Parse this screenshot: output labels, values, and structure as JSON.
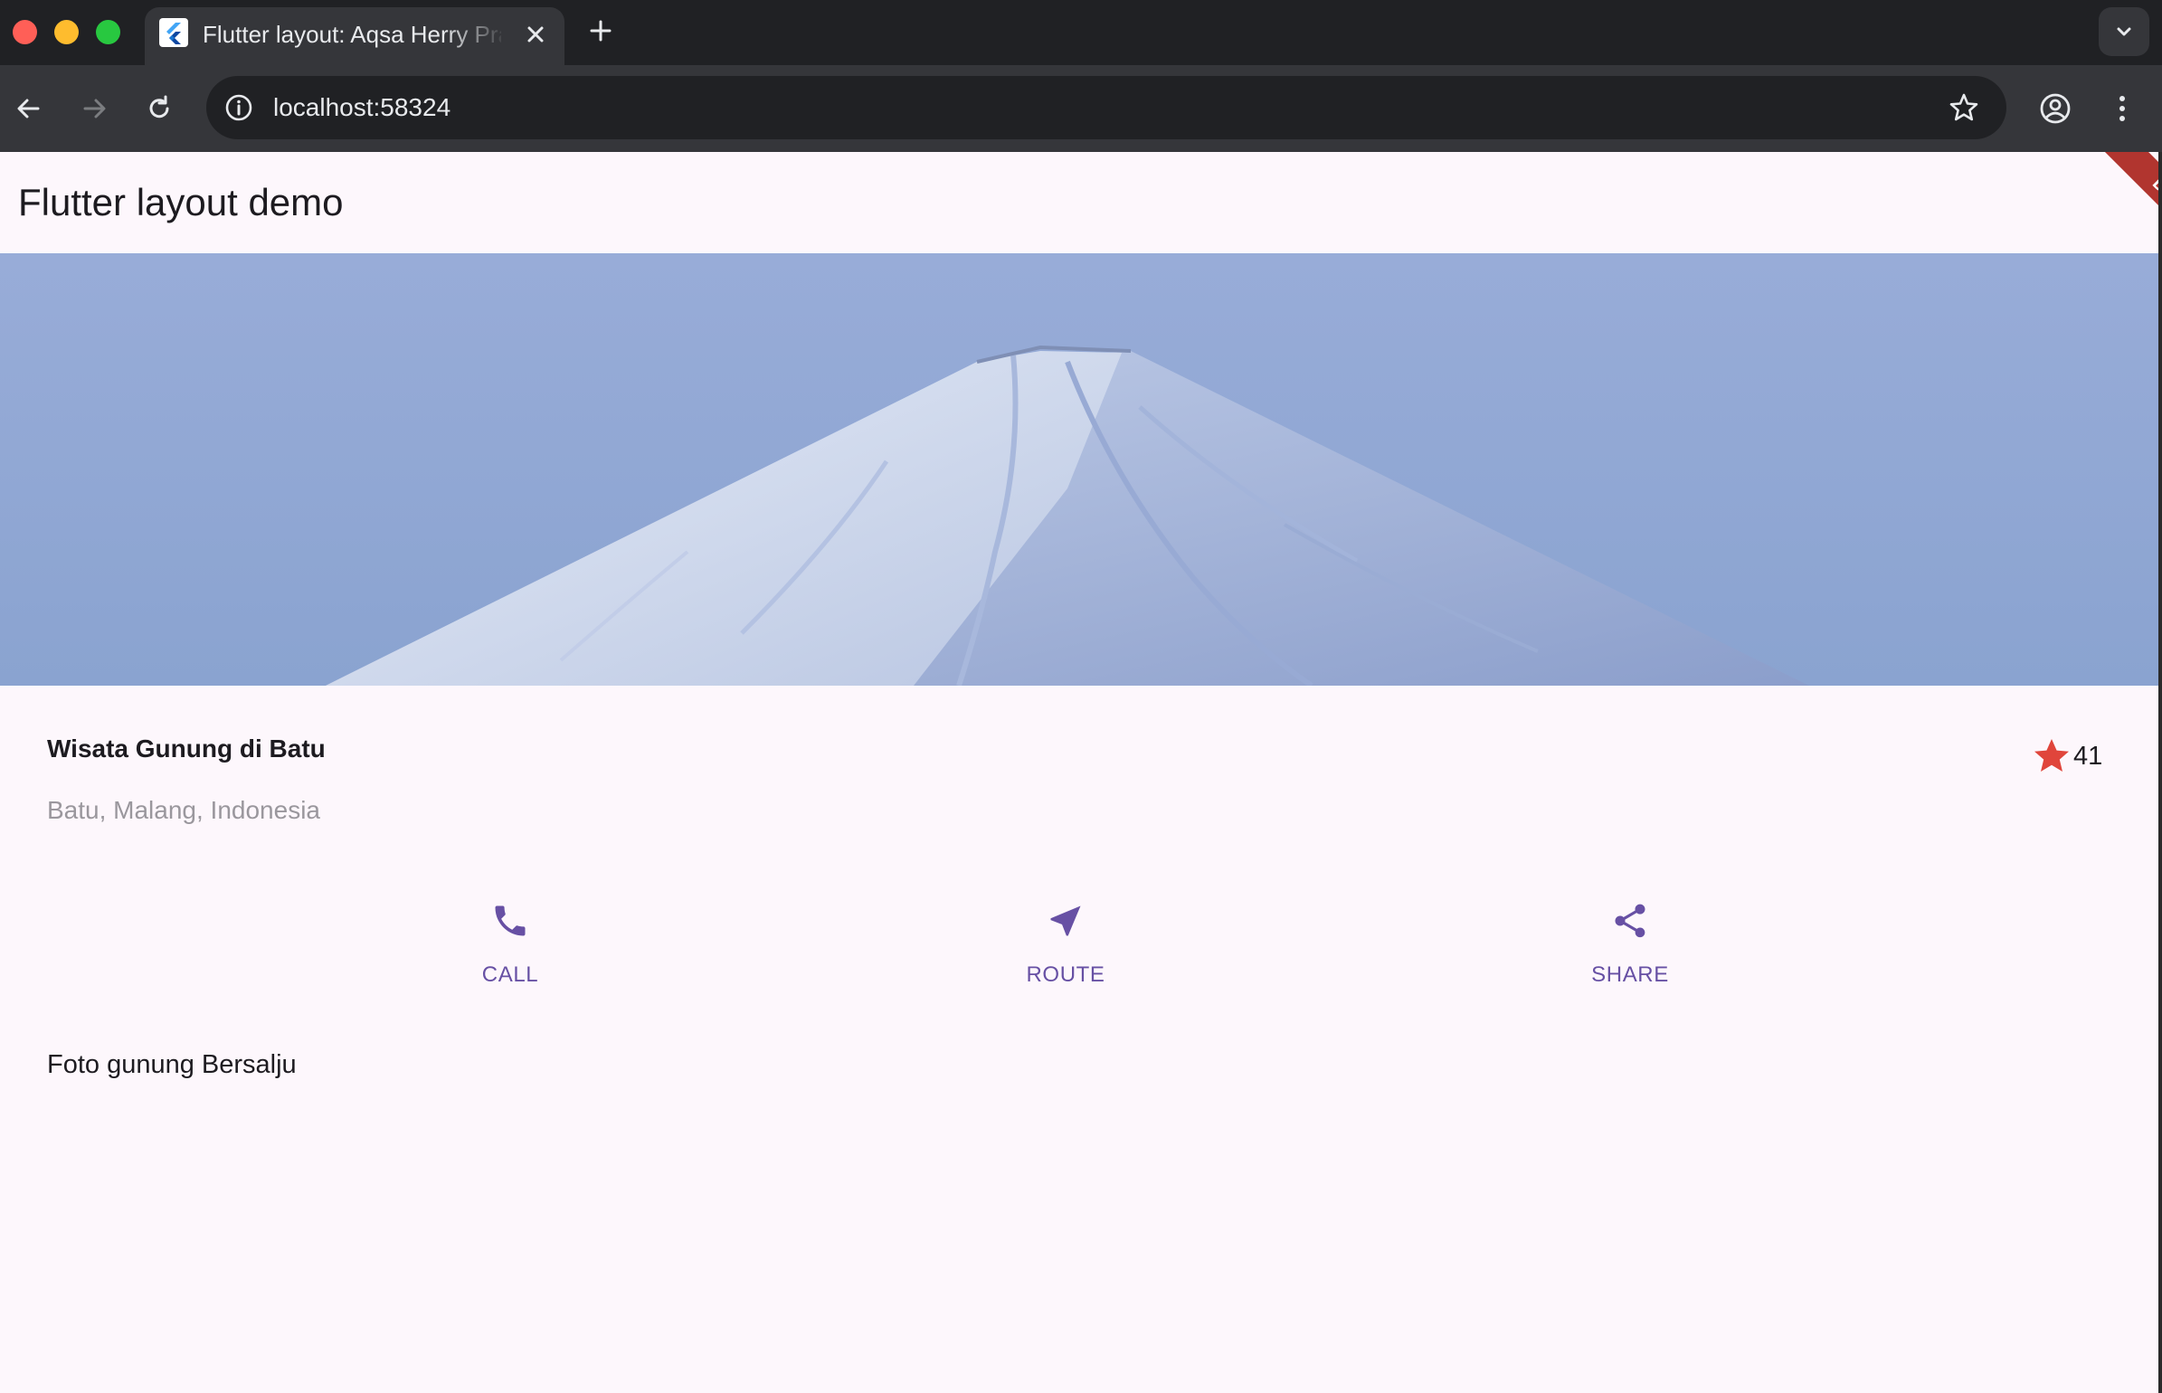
{
  "browser": {
    "tab": {
      "title": "Flutter layout: Aqsa Herry Pratama",
      "favicon": "flutter-logo-icon"
    },
    "address": {
      "url": "localhost:58324"
    },
    "icons": {
      "back": "arrow-left-icon",
      "forward": "arrow-right-icon",
      "reload": "reload-icon",
      "info": "info-icon",
      "bookmark": "star-outline-icon",
      "profile": "account-circle-icon",
      "menu": "more-vert-icon",
      "close_tab": "close-icon",
      "new_tab": "plus-icon",
      "tab_search": "chevron-down-icon"
    }
  },
  "app": {
    "appbar": {
      "title": "Flutter layout demo"
    },
    "debug_banner": "DEBUG",
    "title_section": {
      "name": "Wisata Gunung di Batu",
      "location": "Batu, Malang, Indonesia",
      "rating_count": "41",
      "rating_icon": "star-icon",
      "star_color": "#e0453b"
    },
    "actions": [
      {
        "label": "CALL",
        "icon": "phone-icon"
      },
      {
        "label": "ROUTE",
        "icon": "near-me-icon"
      },
      {
        "label": "SHARE",
        "icon": "share-icon"
      }
    ],
    "description": "Foto gunung Bersalju",
    "colors": {
      "primary": "#6750a4",
      "background": "#fdf7fc",
      "text": "#1d1b20",
      "secondary_text": "#9a979d"
    }
  }
}
